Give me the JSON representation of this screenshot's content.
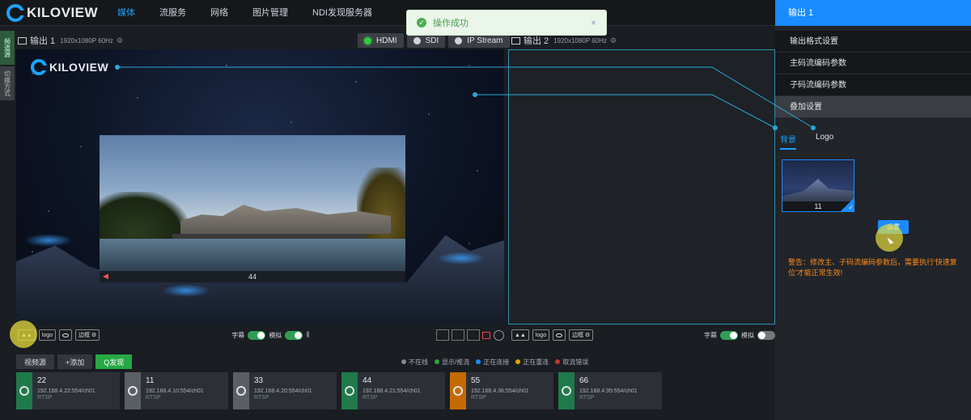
{
  "brand": {
    "name": "KILOVIEW"
  },
  "nav": {
    "items": [
      "媒体",
      "流服务",
      "网络",
      "图片管理",
      "NDI发现服务器"
    ],
    "active": 0
  },
  "toast": {
    "message": "操作成功",
    "close": "×"
  },
  "side_tabs": [
    "频道源",
    "切换方式"
  ],
  "output1": {
    "title": "输出 1",
    "resolution": "1920x1080P 60Hz",
    "tabs": [
      "HDMI",
      "SDI",
      "IP Stream"
    ],
    "active_tab": 0,
    "pip_label": "44",
    "toolbar": {
      "logo": "logo",
      "border": "边框",
      "subtitle": "字幕",
      "analog": "模拟"
    }
  },
  "output2": {
    "title": "输出 2",
    "resolution": "1920x1080P 60Hz",
    "toolbar": {
      "logo": "logo",
      "border": "边框",
      "subtitle": "字幕",
      "analog": "模拟"
    }
  },
  "sources": {
    "buttons": {
      "video_source": "视频源",
      "add": "+添加",
      "discover": "Q发现"
    },
    "legend": [
      {
        "label": "不在线",
        "color": "#888888"
      },
      {
        "label": "显示/推流",
        "color": "#27a745"
      },
      {
        "label": "正在连接",
        "color": "#1a8cff"
      },
      {
        "label": "正在重连",
        "color": "#e0a800"
      },
      {
        "label": "取流错误",
        "color": "#c0392b"
      }
    ],
    "cards": [
      {
        "name": "22",
        "url": "192.168.4.22:554/ch01",
        "protocol": "RTSP",
        "status_color": "#1f7a4a"
      },
      {
        "name": "11",
        "url": "192.168.4.10:554/ch01",
        "protocol": "RTSP",
        "status_color": "#5a5f66"
      },
      {
        "name": "33",
        "url": "192.168.4.20:554/ch01",
        "protocol": "RTSP",
        "status_color": "#5a5f66"
      },
      {
        "name": "44",
        "url": "192.168.4.21:554/ch01",
        "protocol": "RTSP",
        "status_color": "#1f7a4a"
      },
      {
        "name": "55",
        "url": "192.168.4.36:554/ch01",
        "protocol": "RTSP",
        "status_color": "#c56a00"
      },
      {
        "name": "66",
        "url": "192.168.4.95:554/ch01",
        "protocol": "RTSP",
        "status_color": "#1f7a4a"
      }
    ]
  },
  "right_panel": {
    "header": "输出 1",
    "menu": [
      "输出格式设置",
      "主码流编码参数",
      "子码流编码参数",
      "叠加设置"
    ],
    "active_menu": 3,
    "tabs": [
      "背景",
      "Logo"
    ],
    "active_tab": 0,
    "thumbnail_label": "11",
    "set_button": "设置",
    "warning": "警告：修改主、子码流编码参数后，需要执行'快速复位'才能正常生效!"
  },
  "colors": {
    "accent": "#1a8cff",
    "active_green": "#27a745",
    "warning": "#ff8a1a"
  }
}
